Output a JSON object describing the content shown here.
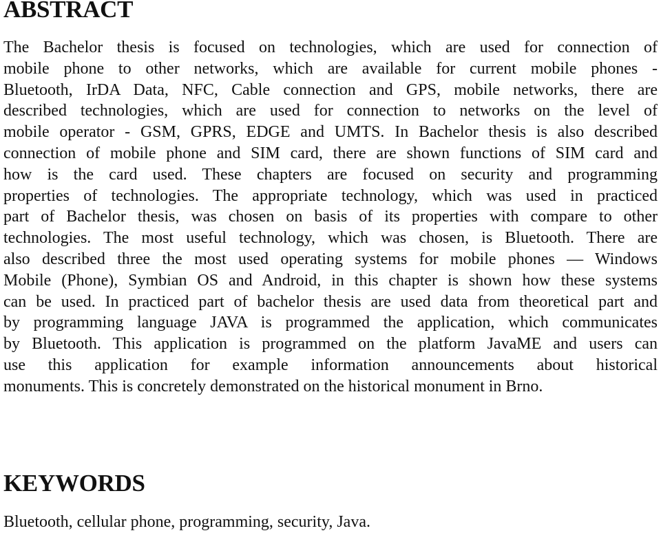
{
  "abstract": {
    "heading": "ABSTRACT",
    "lines": [
      "The Bachelor thesis is focused on technologies, which are used for connection of",
      "mobile phone to other networks, which are available for current mobile phones -",
      "Bluetooth, IrDA Data, NFC, Cable connection and GPS, mobile networks, there are",
      "described technologies, which are used for connection to networks on the level of",
      "mobile operator - GSM, GPRS, EDGE and UMTS.  In Bachelor thesis is also described",
      "connection of mobile phone and SIM card, there are shown functions of SIM card and",
      "how is the card used.  These chapters are focused on security and programming",
      "properties of technologies. The appropriate technology, which was used in practiced",
      "part of Bachelor thesis, was chosen on basis of its properties with compare to other",
      "technologies. The most useful technology, which was chosen, is Bluetooth. There are",
      "also described three the most used operating systems for mobile phones — Windows",
      "Mobile (Phone), Symbian OS and Android, in this chapter is shown how these systems",
      "can be used. In practiced part of bachelor thesis are used data from theoretical part and",
      "by programming language JAVA is programmed the application, which communicates",
      "by Bluetooth. This application is programmed on the platform JavaME and users can",
      "use this application for example information announcements about historical",
      "monuments. This is concretely demonstrated on the historical monument in Brno."
    ]
  },
  "keywords": {
    "heading": "KEYWORDS",
    "text": "Bluetooth, cellular phone, programming, security, Java."
  }
}
